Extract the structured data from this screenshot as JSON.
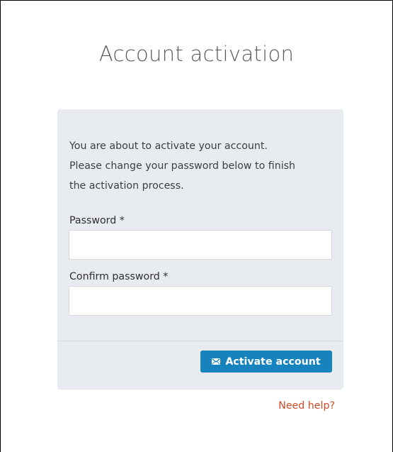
{
  "page": {
    "title": "Account activation"
  },
  "form": {
    "intro_lines": [
      "You are about to activate your account.",
      "Please change your password below to finish",
      "the activation process."
    ],
    "password_label": "Password *",
    "password_value": "",
    "confirm_label": "Confirm password *",
    "confirm_value": "",
    "submit_label": "Activate account",
    "submit_icon": "envelope-icon"
  },
  "footer": {
    "help_link": "Need help?"
  },
  "colors": {
    "card_background": "#e8ecf0",
    "button_primary": "#1683be",
    "link_accent": "#d04a2a"
  }
}
